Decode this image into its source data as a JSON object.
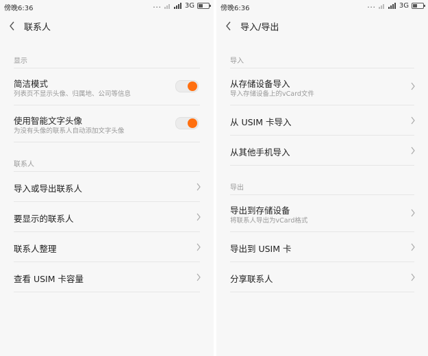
{
  "status_bar": {
    "time": "傍晚6:36",
    "signal_dots": "...",
    "network": "3G"
  },
  "colors": {
    "accent": "#ff6f0f",
    "battery_level": 0.4
  },
  "icons": {
    "back": "chevron-left-icon",
    "chevron": "chevron-right-icon"
  },
  "left": {
    "title": "联系人",
    "section_display": "显示",
    "simple_mode": {
      "title": "简洁模式",
      "subtitle": "列表页不显示头像、归属地、公司等信息",
      "enabled": true
    },
    "smart_avatar": {
      "title": "使用智能文字头像",
      "subtitle": "为没有头像的联系人自动添加文字头像",
      "enabled": true
    },
    "section_contacts": "联系人",
    "items": [
      "导入或导出联系人",
      "要显示的联系人",
      "联系人整理",
      "查看 USIM 卡容量"
    ]
  },
  "right": {
    "title": "导入/导出",
    "section_import": "导入",
    "import_storage": {
      "title": "从存储设备导入",
      "subtitle": "导入存储设备上的vCard文件"
    },
    "import_usim": "从 USIM 卡导入",
    "import_other": "从其他手机导入",
    "section_export": "导出",
    "export_storage": {
      "title": "导出到存储设备",
      "subtitle": "将联系人导出为vCard格式"
    },
    "export_usim": "导出到 USIM 卡",
    "share": "分享联系人"
  }
}
